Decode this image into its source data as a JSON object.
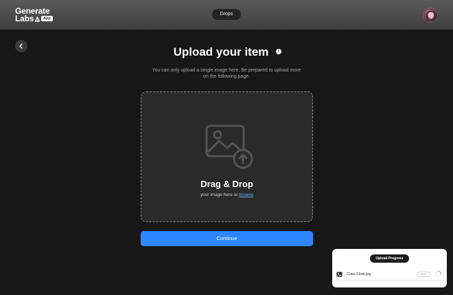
{
  "header": {
    "logo": {
      "line1": "Generate",
      "line2": "Labs",
      "badge": "App"
    },
    "nav_pill": "Drops",
    "avatar_icon": "user-avatar"
  },
  "main": {
    "back_icon": "chevron-left-icon",
    "title": "Upload your item",
    "info_icon_label": "i",
    "subtitle": "You can only upload a single image here.  Be prepared to upload more on the following page.",
    "dropzone": {
      "icon": "image-upload-icon",
      "heading": "Drag & Drop",
      "text": "your image here or ",
      "browse_link": "browse"
    },
    "continue_label": "Continue"
  },
  "upload_panel": {
    "title": "Upload Progress",
    "file": {
      "icon": "image-file-icon",
      "name": "Coke Float.jpg",
      "status_chip": "0/100",
      "spinner_icon": "loading-spinner-icon"
    }
  },
  "colors": {
    "background": "#171717",
    "header": "#4a4a4a",
    "accent": "#2e86ff",
    "link": "#6aa8ff",
    "dropzone": "#2a2a2a"
  }
}
